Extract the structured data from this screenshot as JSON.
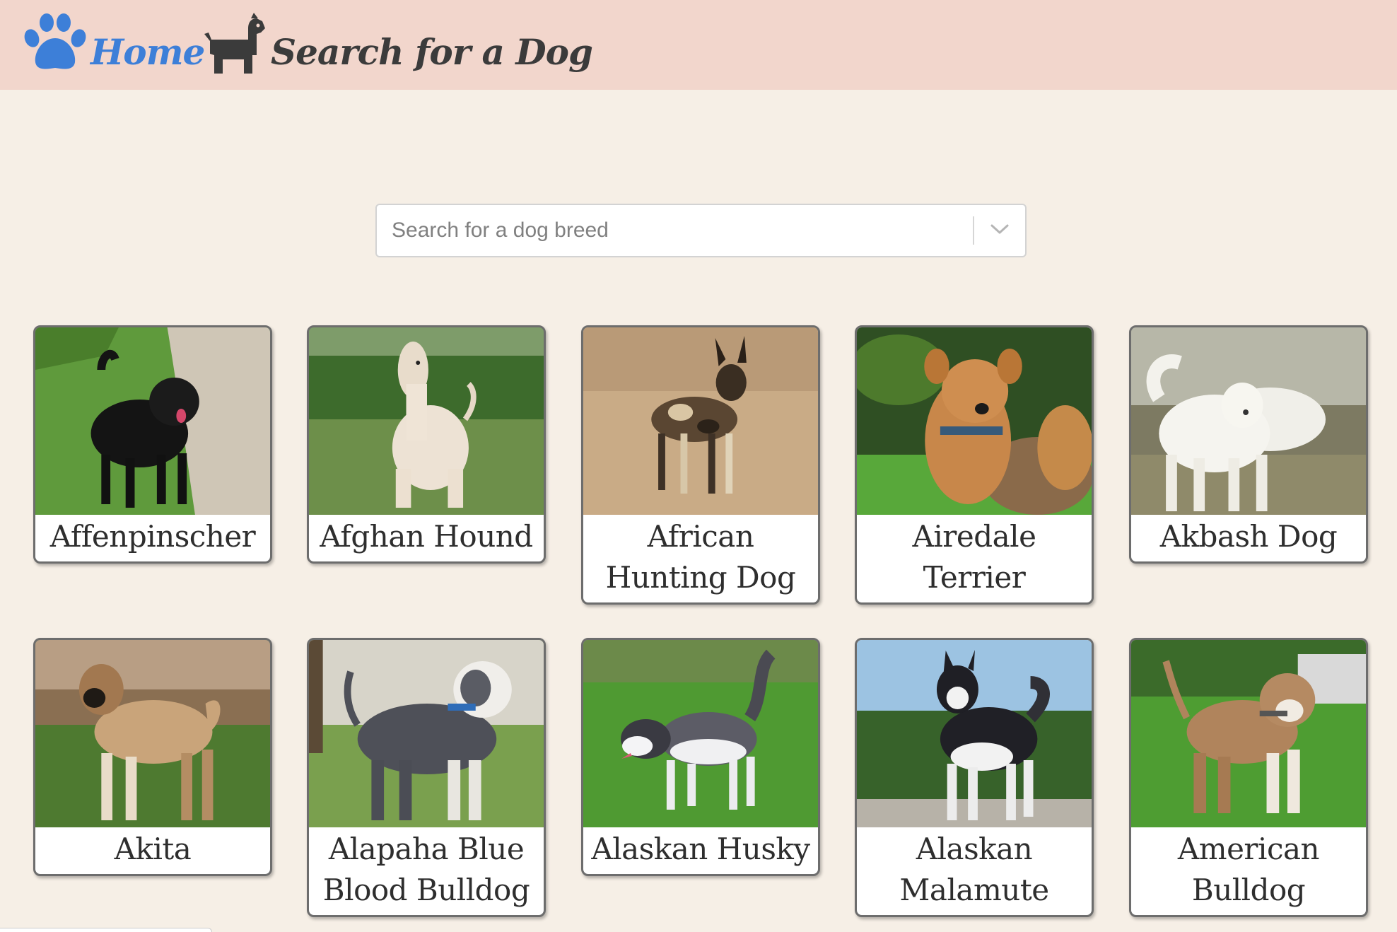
{
  "nav": {
    "home_label": "Home",
    "search_label": "Search for a Dog",
    "home_icon": "paw-icon",
    "search_icon": "dog-icon",
    "home_color": "#3d7fd8",
    "bar_color": "#f2d6cc"
  },
  "search": {
    "placeholder": "Search for a dog breed",
    "dropdown_icon": "chevron-down-icon"
  },
  "breeds": [
    {
      "name": "Affenpinscher"
    },
    {
      "name": "Afghan Hound"
    },
    {
      "name": "African Hunting Dog"
    },
    {
      "name": "Airedale Terrier"
    },
    {
      "name": "Akbash Dog"
    },
    {
      "name": "Akita"
    },
    {
      "name": "Alapaha Blue Blood Bulldog"
    },
    {
      "name": "Alaskan Husky"
    },
    {
      "name": "Alaskan Malamute"
    },
    {
      "name": "American Bulldog"
    }
  ]
}
